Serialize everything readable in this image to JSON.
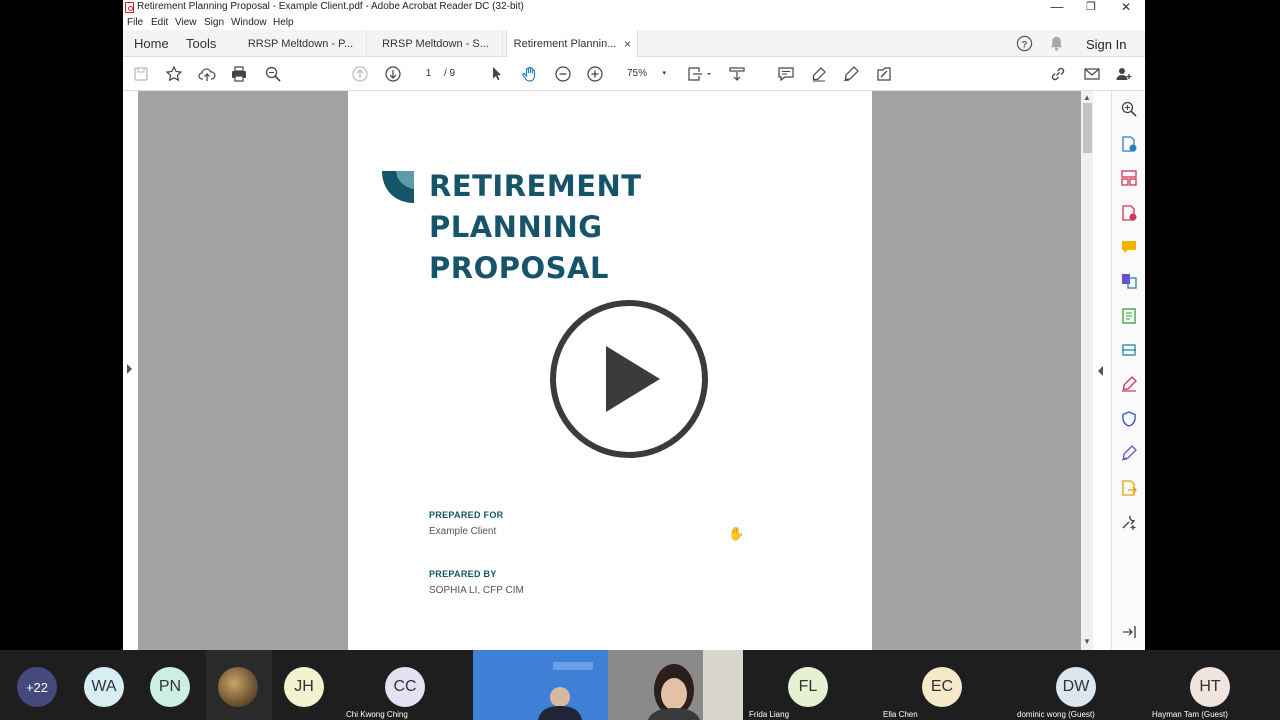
{
  "window": {
    "title": "Retirement Planning Proposal - Example Client.pdf - Adobe Acrobat Reader DC (32-bit)",
    "minimize": "—",
    "maximize": "❐",
    "close": "✕"
  },
  "menu": [
    "File",
    "Edit",
    "View",
    "Sign",
    "Window",
    "Help"
  ],
  "nav": {
    "home": "Home",
    "tools": "Tools",
    "sign_in": "Sign In"
  },
  "tabs": [
    {
      "label": "RRSP Meltdown - P...",
      "active": false
    },
    {
      "label": "RRSP Meltdown - S...",
      "active": false
    },
    {
      "label": "Retirement Plannin...",
      "active": true,
      "close": "×"
    }
  ],
  "toolbar": {
    "page_current": "1",
    "page_total": "/ 9",
    "zoom": "75%",
    "zoom_caret": "▾"
  },
  "document": {
    "title_lines": [
      "RETIREMENT",
      "PLANNING",
      "PROPOSAL"
    ],
    "prepared_for_label": "PREPARED FOR",
    "prepared_for_value": "Example Client",
    "prepared_by_label": "PREPARED BY",
    "prepared_by_value": "SOPHIA LI, CFP CIM"
  },
  "participants": {
    "more_count": "+22",
    "people": [
      {
        "initials": "WA",
        "name": "",
        "color": "#d7eef5"
      },
      {
        "initials": "PN",
        "name": "",
        "color": "#cdeee2"
      },
      {
        "initials": "JH",
        "name": "",
        "color": "#f1f2cf"
      },
      {
        "initials": "CC",
        "name": "Chi Kwong Ching",
        "color": "#e3e2f3"
      },
      {
        "initials": "FL",
        "name": "Frida Liang",
        "color": "#e6f1d4"
      },
      {
        "initials": "EC",
        "name": "Ella Chen",
        "color": "#f6e9c9"
      },
      {
        "initials": "DW",
        "name": "dominic wong (Guest)",
        "color": "#dbe6ee"
      },
      {
        "initials": "HT",
        "name": "Hayman Tam (Guest)",
        "color": "#f0e4df"
      }
    ]
  },
  "colors": {
    "brand": "#16546a",
    "viewer_gray": "#a3a3a3"
  }
}
